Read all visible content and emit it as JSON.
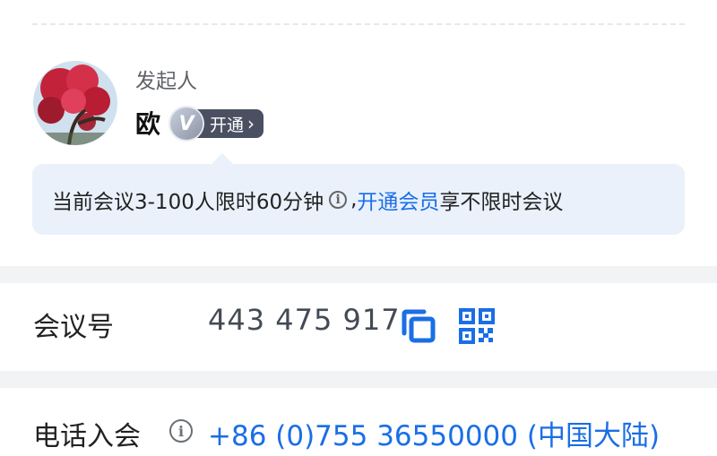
{
  "host": {
    "label": "发起人",
    "name": "欧",
    "vip_letter": "V",
    "vip_action": "开通",
    "avatar_description": "avatar photo of red flowering tree"
  },
  "notice": {
    "text_before": "当前会议3-100人限时60分钟",
    "separator": ",",
    "link_text": "开通会员",
    "text_after": "享不限时会议"
  },
  "meeting": {
    "label": "会议号",
    "number": "443 475 917"
  },
  "phone": {
    "label": "电话入会",
    "number": "+86 (0)755 36550000 (中国大陆)"
  },
  "icons": {
    "info": "info-icon",
    "copy": "copy-icon",
    "qr": "qr-code-icon",
    "chevron": "chevron-right-icon"
  },
  "colors": {
    "link": "#1a6ee6",
    "notice_bg": "#eaf1fb",
    "separator": "#f2f3f5",
    "vip_pill": "#4a5061"
  }
}
